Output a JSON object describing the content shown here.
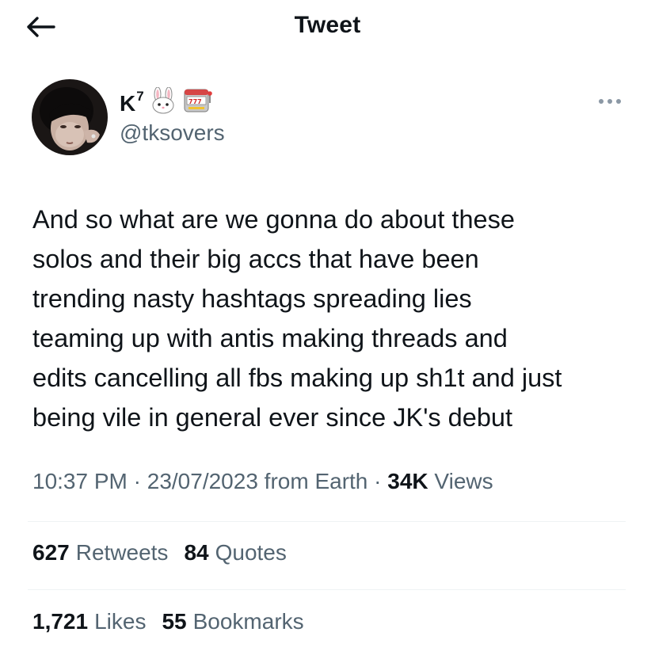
{
  "header": {
    "title": "Tweet",
    "back_icon": "arrow-left-icon"
  },
  "author": {
    "name": "K",
    "name_sup": "7",
    "emojis": [
      "rabbit-face-emoji",
      "slot-machine-emoji"
    ],
    "handle": "@tksovers"
  },
  "more_icon": "ellipsis-icon",
  "tweet": {
    "text": "And so what are we gonna do about these\nsolos and their big accs that have been\ntrending nasty hashtags spreading lies\nteaming up with antis making threads and\nedits cancelling all fbs making up sh1t and just\nbeing vile in general ever since JK's debut"
  },
  "meta": {
    "time": "10:37 PM",
    "separator": "·",
    "date": "23/07/2023",
    "source": "from Earth",
    "views_count": "34K",
    "views_label": "Views"
  },
  "stats": {
    "retweets_count": "627",
    "retweets_label": "Retweets",
    "quotes_count": "84",
    "quotes_label": "Quotes",
    "likes_count": "1,721",
    "likes_label": "Likes",
    "bookmarks_count": "55",
    "bookmarks_label": "Bookmarks"
  },
  "colors": {
    "text": "#0f1419",
    "secondary": "#536471",
    "divider": "#eff3f4"
  }
}
